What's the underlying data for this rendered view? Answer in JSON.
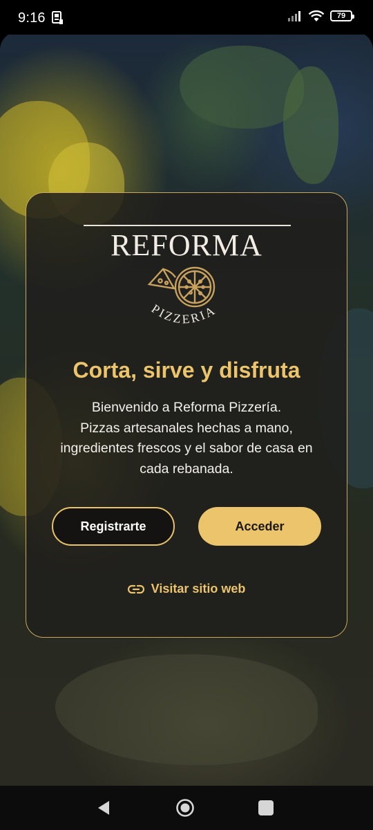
{
  "status_bar": {
    "time": "9:16",
    "battery_level": "79",
    "icons": [
      "notification-icon",
      "signal-icon",
      "wifi-icon",
      "battery-icon"
    ]
  },
  "card": {
    "logo": {
      "brand": "REFORMA",
      "subtitle": "PIZZERIA"
    },
    "headline": "Corta, sirve y disfruta",
    "description_lines": [
      "Bienvenido a Reforma Pizzería.",
      "Pizzas artesanales hechas a mano,",
      "ingredientes frescos y el sabor de casa en",
      "cada rebanada."
    ],
    "register_label": "Registrarte",
    "login_label": "Acceder",
    "web_link_label": "Visitar sitio web",
    "web_link_icon": "link-icon"
  },
  "nav_bar": {
    "icons": [
      "back-icon",
      "home-icon",
      "recents-icon"
    ]
  },
  "colors": {
    "accent": "#ecc46b",
    "card_border": "#c9a85a",
    "card_background": "#201e1c",
    "headline": "#ecc46b"
  }
}
